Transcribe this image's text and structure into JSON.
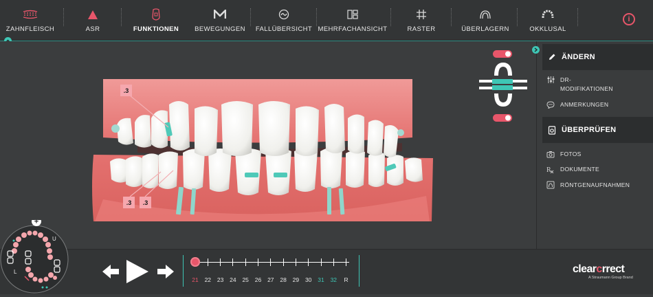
{
  "toolbar": {
    "items": [
      {
        "label": "ZAHNFLEISCH",
        "icon": "gum-icon"
      },
      {
        "label": "ASR",
        "icon": "triangle-icon"
      },
      {
        "label": "FUNKTIONEN",
        "icon": "tooth-feature-icon"
      },
      {
        "label": "BEWEGUNGEN",
        "icon": "movement-icon"
      },
      {
        "label": "FALLÜBERSICHT",
        "icon": "case-overview-icon"
      },
      {
        "label": "MEHRFACHANSICHT",
        "icon": "multi-view-icon"
      },
      {
        "label": "RASTER",
        "icon": "grid-icon"
      },
      {
        "label": "ÜBERLAGERN",
        "icon": "overlay-icon"
      },
      {
        "label": "OKKLUSAL",
        "icon": "occlusal-icon"
      }
    ],
    "info_icon": "info-icon",
    "info_glyph": "i"
  },
  "attachment_labels": [
    ".3",
    ".3",
    ".3"
  ],
  "side_panel": {
    "aendern": {
      "title": "ÄNDERN",
      "icon": "pencil-icon",
      "items": [
        {
          "label": "DR-\nMODIFIKATIONEN",
          "icon": "sliders-icon"
        },
        {
          "label": "ANMERKUNGEN",
          "icon": "comment-icon"
        }
      ]
    },
    "ueberpruefen": {
      "title": "ÜBERPRÜFEN",
      "icon": "review-icon",
      "items": [
        {
          "label": "FOTOS",
          "icon": "camera-icon"
        },
        {
          "label": "DOKUMENTE",
          "icon": "rx-icon"
        },
        {
          "label": "RÖNTGENAUFNAHMEN",
          "icon": "xray-icon"
        }
      ]
    }
  },
  "minimap": {
    "upper_label": "U",
    "lower_label": "L",
    "plus": "+"
  },
  "timeline": {
    "ticks": [
      "21",
      "22",
      "23",
      "24",
      "25",
      "26",
      "27",
      "28",
      "29",
      "30",
      "31",
      "32",
      "R"
    ],
    "current": "21",
    "tick_colors": {
      "21": "#e8566a",
      "31": "#3ec6b5",
      "32": "#3ec6b5"
    }
  },
  "brand": {
    "name_a": "clear",
    "name_b": "c",
    "name_c": "rrect",
    "tagline": "A Straumann Group Brand"
  },
  "colors": {
    "accent_teal": "#3ec6b5",
    "accent_red": "#e8566a",
    "gum": "#e8706e",
    "tooth": "#f2f2f0"
  }
}
